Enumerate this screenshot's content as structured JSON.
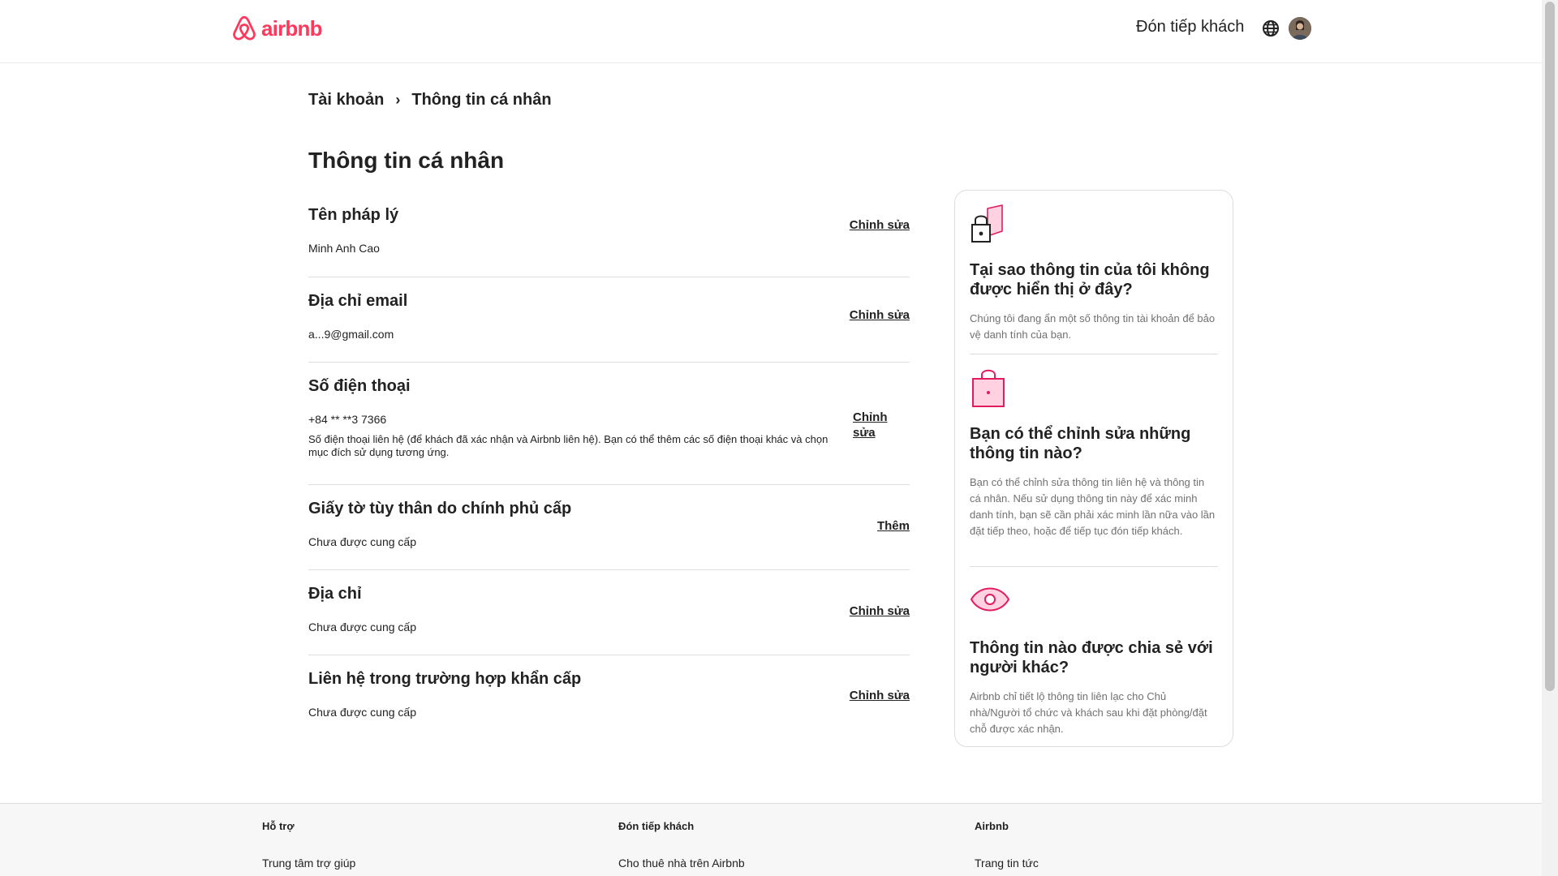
{
  "header": {
    "logo_text": "airbnb",
    "host_link": "Đón tiếp khách",
    "brand_color": "#ff385c",
    "icons": [
      "airbnb-logo-icon",
      "globe-icon",
      "avatar"
    ]
  },
  "breadcrumb": {
    "parent": "Tài khoản",
    "separator": "›",
    "current": "Thông tin cá nhân"
  },
  "page": {
    "title": "Thông tin cá nhân"
  },
  "rows": [
    {
      "title": "Tên pháp lý",
      "value": "Minh Anh Cao",
      "action": "Chỉnh sửa"
    },
    {
      "title": "Địa chỉ email",
      "value": "a...9@gmail.com",
      "action": "Chỉnh sửa"
    },
    {
      "title": "Số điện thoại",
      "value": "+84 ** **3 7366",
      "description": "Số điện thoại liên hệ (để khách đã xác nhận và Airbnb liên hệ). Bạn có thể thêm các số điện thoại khác và chọn mục đích sử dụng tương ứng.",
      "action": "Chỉnh sửa"
    },
    {
      "title": "Giấy tờ tùy thân do chính phủ cấp",
      "value": "Chưa được cung cấp",
      "action": "Thêm"
    },
    {
      "title": "Địa chỉ",
      "value": "Chưa được cung cấp",
      "action": "Chỉnh sửa"
    },
    {
      "title": "Liên hệ trong trường hợp khẩn cấp",
      "value": "Chưa được cung cấp",
      "action": "Chỉnh sửa"
    }
  ],
  "info_card": {
    "sections": [
      {
        "icon": "lock-icon",
        "title": "Tại sao thông tin của tôi không được hiển thị ở đây?",
        "text": "Chúng tôi đang ẩn một số thông tin tài khoản để bảo vệ danh tính của bạn."
      },
      {
        "icon": "locked-bag-icon",
        "title": "Bạn có thể chỉnh sửa những thông tin nào?",
        "text": "Bạn có thể chỉnh sửa thông tin liên hệ và thông tin cá nhân. Nếu sử dụng thông tin này để xác minh danh tính, bạn sẽ cần phải xác minh lần nữa vào lần đặt tiếp theo, hoặc để tiếp tục đón tiếp khách."
      },
      {
        "icon": "eye-icon",
        "title": "Thông tin nào được chia sẻ với người khác?",
        "text": "Airbnb chỉ tiết lộ thông tin liên lạc cho Chủ nhà/Người tổ chức và khách sau khi đặt phòng/đặt chỗ được xác nhận."
      }
    ]
  },
  "footer": {
    "columns": [
      {
        "heading": "Hỗ trợ",
        "link": "Trung tâm trợ giúp"
      },
      {
        "heading": "Đón tiếp khách",
        "link": "Cho thuê nhà trên Airbnb"
      },
      {
        "heading": "Airbnb",
        "link": "Trang tin tức"
      }
    ]
  }
}
